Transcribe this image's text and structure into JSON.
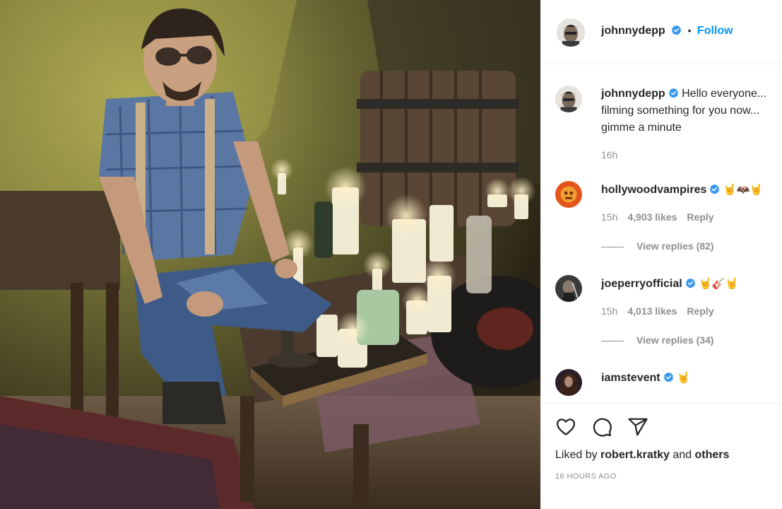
{
  "post": {
    "author": "johnnydepp",
    "follow_label": "Follow",
    "separator": "•",
    "photo_label": "Photo of a man seated by a table of lit candles in a stone cellar"
  },
  "caption": {
    "author": "johnnydepp",
    "text": "Hello everyone... filming something for you now... gimme a minute",
    "time": "16h"
  },
  "comments": [
    {
      "author": "hollywoodvampires",
      "emoji": "🤘🦇🤘",
      "time": "15h",
      "likes": "4,903 likes",
      "reply": "Reply",
      "view_replies": "View replies (82)"
    },
    {
      "author": "joeperryofficial",
      "emoji": "🤘🎸🤘",
      "time": "15h",
      "likes": "4,013 likes",
      "reply": "Reply",
      "view_replies": "View replies (34)"
    },
    {
      "author": "iamstevent",
      "emoji": "🤘"
    }
  ],
  "actions": {
    "liked_by_prefix": "Liked by ",
    "liked_by_user": "robert.kratky",
    "liked_by_mid": " and ",
    "liked_by_others": "others",
    "timestamp": "16 HOURS AGO"
  },
  "colors": {
    "link": "#0095f6",
    "verified": "#3897f0",
    "muted": "#8e8e8e"
  }
}
